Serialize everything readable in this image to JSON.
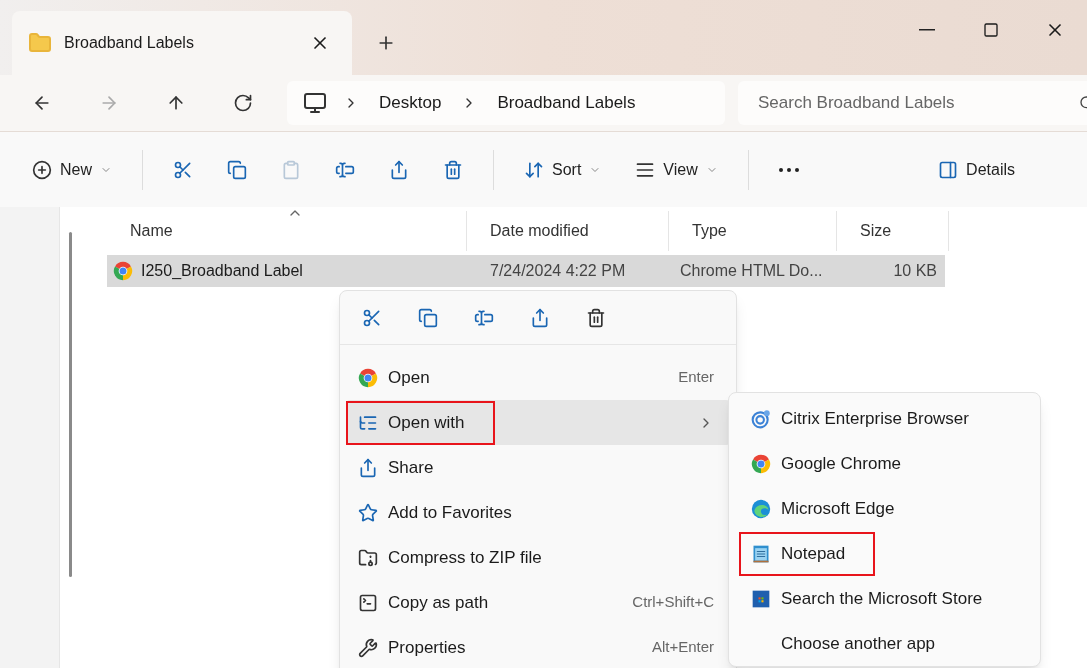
{
  "tabs": [
    {
      "label": "Broadband Labels",
      "selected": true
    }
  ],
  "address": {
    "breadcrumbs": [
      "Desktop",
      "Broadband Labels"
    ]
  },
  "search": {
    "placeholder": "Search Broadband Labels"
  },
  "toolbar": [
    {
      "kind": "new",
      "label": "New",
      "disabled": false
    },
    {
      "kind": "cut",
      "disabled": false
    },
    {
      "kind": "copy",
      "disabled": false
    },
    {
      "kind": "paste",
      "disabled": true
    },
    {
      "kind": "rename",
      "disabled": false
    },
    {
      "kind": "share",
      "disabled": false
    },
    {
      "kind": "delete",
      "disabled": false
    },
    {
      "kind": "sort",
      "label": "Sort",
      "disabled": false
    },
    {
      "kind": "view",
      "label": "View",
      "disabled": false
    },
    {
      "kind": "more",
      "disabled": false
    },
    {
      "kind": "details",
      "label": "Details",
      "disabled": false
    }
  ],
  "table": {
    "columns": [
      {
        "label": "Name",
        "sorted": true
      },
      {
        "label": "Date modified",
        "sorted": false
      },
      {
        "label": "Type",
        "sorted": false
      },
      {
        "label": "Size",
        "sorted": false
      }
    ],
    "rows": [
      {
        "name": "I250_Broadband Label",
        "date": "7/24/2024 4:22 PM",
        "type": "Chrome HTML Do...",
        "size": "10 KB",
        "selected": true
      }
    ]
  },
  "context_menu": {
    "quick_actions": [
      {
        "kind": "cut"
      },
      {
        "kind": "copy"
      },
      {
        "kind": "rename"
      },
      {
        "kind": "share"
      },
      {
        "kind": "delete"
      }
    ],
    "items": [
      {
        "kind": "chrome",
        "label": "Open",
        "shortcut": "Enter",
        "selected": false,
        "highlighted": false,
        "submenu": false
      },
      {
        "kind": "open-with",
        "label": "Open with",
        "selected": true,
        "highlighted": true,
        "submenu": true
      },
      {
        "kind": "share",
        "label": "Share",
        "selected": false,
        "highlighted": false,
        "submenu": false
      },
      {
        "kind": "star",
        "label": "Add to Favorites",
        "selected": false,
        "highlighted": false,
        "submenu": false
      },
      {
        "kind": "zip",
        "label": "Compress to ZIP file",
        "selected": false,
        "highlighted": false,
        "submenu": false
      },
      {
        "kind": "path",
        "label": "Copy as path",
        "shortcut": "Ctrl+Shift+C",
        "selected": false,
        "highlighted": false,
        "submenu": false
      },
      {
        "kind": "wrench",
        "label": "Properties",
        "shortcut": "Alt+Enter",
        "selected": false,
        "highlighted": false,
        "submenu": false
      }
    ]
  },
  "submenu": {
    "items": [
      {
        "kind": "citrix",
        "label": "Citrix Enterprise Browser",
        "highlighted": false
      },
      {
        "kind": "chrome",
        "label": "Google Chrome",
        "highlighted": false
      },
      {
        "kind": "edge",
        "label": "Microsoft Edge",
        "highlighted": false
      },
      {
        "kind": "notepad",
        "label": "Notepad",
        "highlighted": true
      },
      {
        "kind": "store",
        "label": "Search the Microsoft Store",
        "highlighted": false
      },
      {
        "kind": "none",
        "label": "Choose another app",
        "highlighted": false
      }
    ]
  }
}
